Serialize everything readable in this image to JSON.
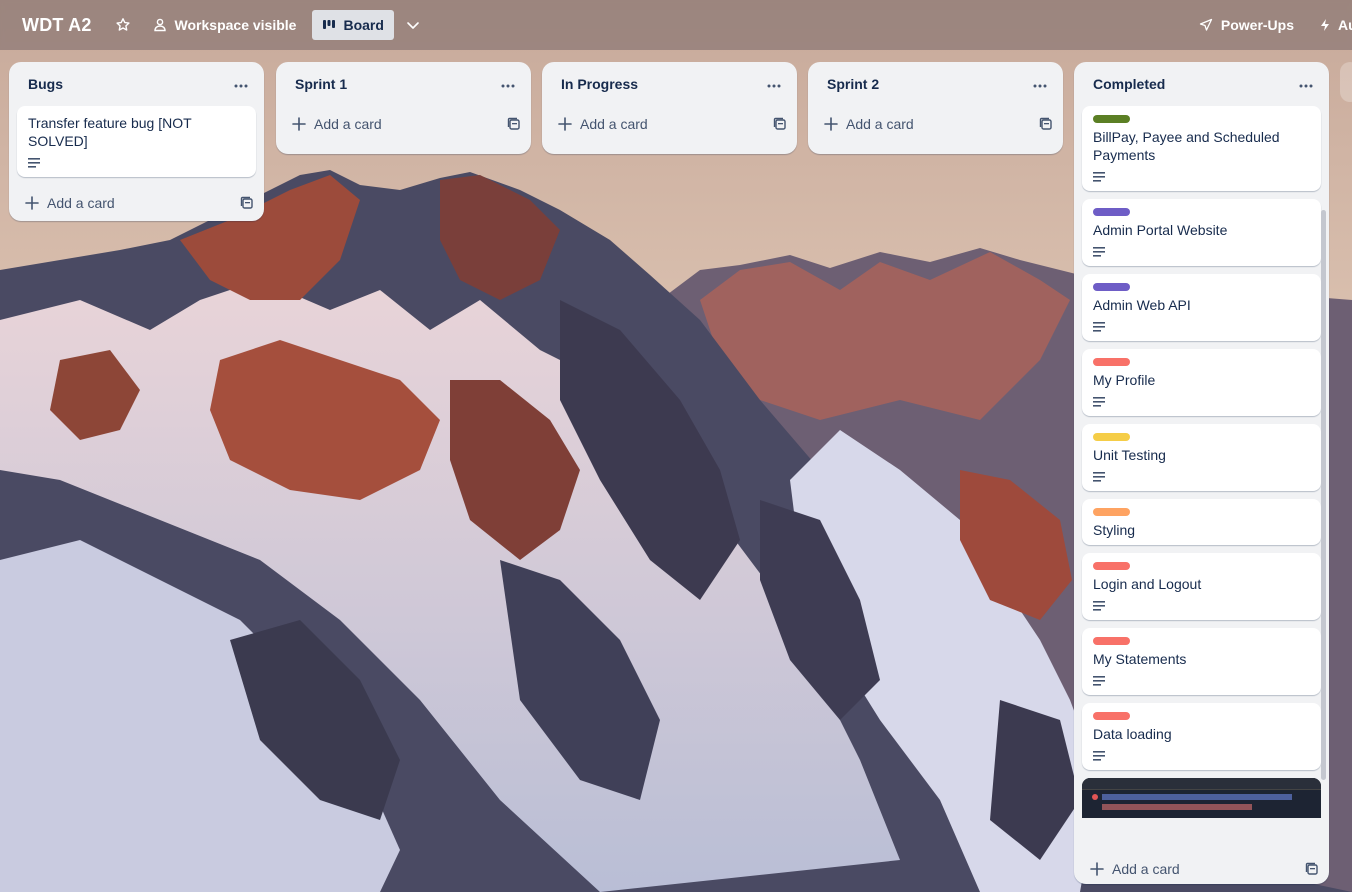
{
  "header": {
    "board_title": "WDT A2",
    "visibility_label": "Workspace visible",
    "view_label": "Board",
    "powerups_label": "Power-Ups",
    "automation_label": "Automation"
  },
  "lists": {
    "bugs": {
      "title": "Bugs",
      "cards": [
        {
          "title": "Transfer feature bug [NOT SOLVED]"
        }
      ],
      "add_label": "Add a card"
    },
    "sprint1": {
      "title": "Sprint 1",
      "add_label": "Add a card"
    },
    "in_progress": {
      "title": "In Progress",
      "add_label": "Add a card"
    },
    "sprint2": {
      "title": "Sprint 2",
      "add_label": "Add a card"
    },
    "completed": {
      "title": "Completed",
      "cards": [
        {
          "title": "BillPay, Payee and Scheduled Payments",
          "label_color": "#5b7f24"
        },
        {
          "title": "Admin Portal Website",
          "label_color": "#6e5dc6"
        },
        {
          "title": "Admin Web API",
          "label_color": "#6e5dc6"
        },
        {
          "title": "My Profile",
          "label_color": "#f87168"
        },
        {
          "title": "Unit Testing",
          "label_color": "#f5cd47"
        },
        {
          "title": "Styling",
          "label_color": "#fea362"
        },
        {
          "title": "Login and Logout",
          "label_color": "#f87168"
        },
        {
          "title": "My Statements",
          "label_color": "#f87168"
        },
        {
          "title": "Data loading",
          "label_color": "#f87168"
        }
      ],
      "add_label": "Add a card"
    }
  }
}
